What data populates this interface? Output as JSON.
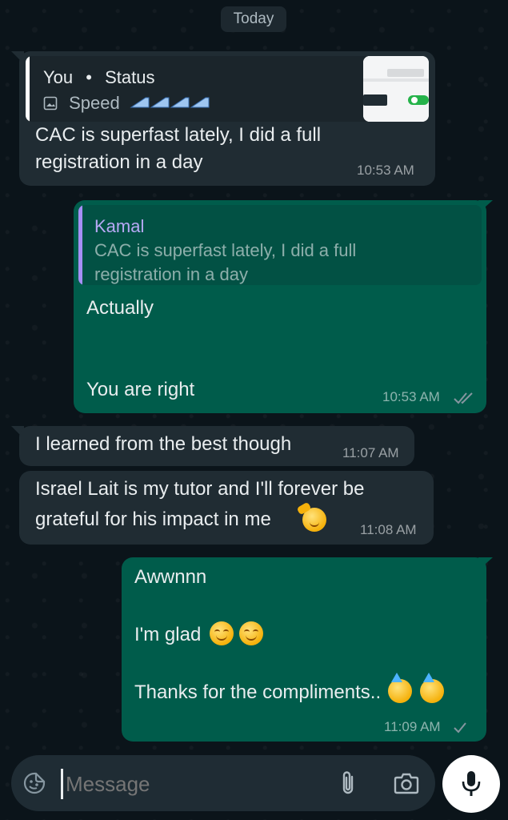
{
  "date_pill": "Today",
  "messages": [
    {
      "quote_author": "You",
      "quote_sep": "•",
      "quote_context": "Status",
      "quote_media_label": "Speed",
      "text_line1": "CAC is superfast lately, I did a full",
      "text_line2": "registration in a day",
      "time": "10:53 AM"
    },
    {
      "quote_author": "Kamal",
      "quote_line1": "CAC is superfast lately, I did a full",
      "quote_line2": "registration in a day",
      "text_line1": "Actually",
      "text_line2": "You are right",
      "time": "10:53 AM"
    },
    {
      "text": "I learned from the best though",
      "time": "11:07 AM"
    },
    {
      "text_line1": "Israel Lait is my tutor and I'll forever be",
      "text_line2": "grateful for his impact in me",
      "time": "11:08 AM"
    },
    {
      "text_line1": "Awwnnn",
      "text_line2": "I'm glad",
      "text_line3": "Thanks for the compliments..",
      "time": "11:09 AM"
    }
  ],
  "composer": {
    "placeholder": "Message"
  },
  "colors": {
    "incoming_bubble": "#202c33",
    "outgoing_bubble": "#005c4b",
    "read_ticks": "#8696a0",
    "quote_bar_mine": "#ffffff",
    "quote_bar_other": "#a68ff5",
    "quote_author_other": "#b8a9f5"
  }
}
